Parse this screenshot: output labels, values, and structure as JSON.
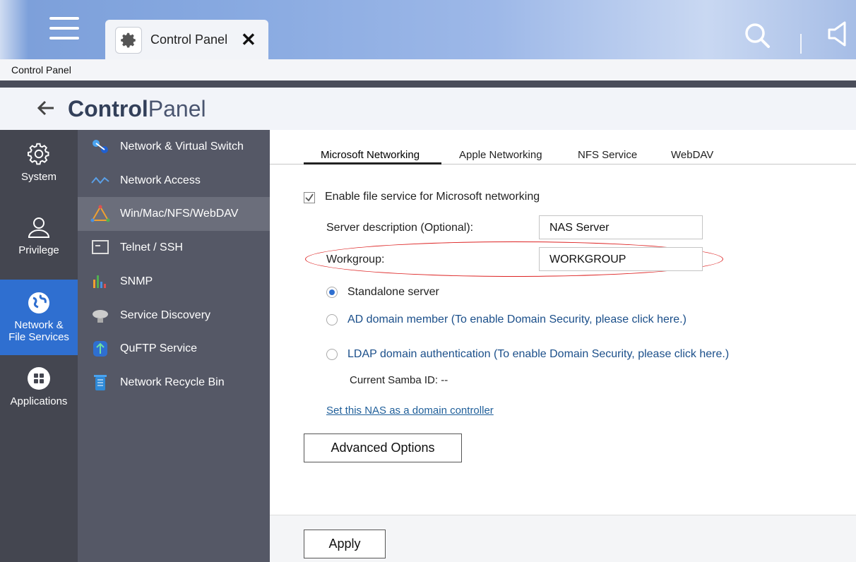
{
  "window": {
    "tab_title": "Control Panel",
    "breadcrumb": "Control Panel"
  },
  "header": {
    "title_bold": "Control",
    "title_light": "Panel"
  },
  "rail": [
    {
      "label": "System",
      "icon": "gear-icon"
    },
    {
      "label": "Privilege",
      "icon": "user-icon"
    },
    {
      "label_line1": "Network &",
      "label_line2": "File Services",
      "icon": "globe-icon",
      "active": true
    },
    {
      "label": "Applications",
      "icon": "apps-grid-icon"
    }
  ],
  "submenu": [
    {
      "label": "Network & Virtual Switch",
      "icon": "network-switch-icon"
    },
    {
      "label": "Network Access",
      "icon": "network-access-icon"
    },
    {
      "label": "Win/Mac/NFS/WebDAV",
      "icon": "file-protocols-icon",
      "active": true
    },
    {
      "label": "Telnet / SSH",
      "icon": "terminal-icon"
    },
    {
      "label": "SNMP",
      "icon": "bar-chart-icon"
    },
    {
      "label": "Service Discovery",
      "icon": "satellite-dish-icon"
    },
    {
      "label": "QuFTP Service",
      "icon": "ftp-icon"
    },
    {
      "label": "Network Recycle Bin",
      "icon": "recycle-bin-icon"
    }
  ],
  "tabs": [
    "Microsoft Networking",
    "Apple Networking",
    "NFS Service",
    "WebDAV"
  ],
  "form": {
    "enable_label": "Enable file service for Microsoft networking",
    "server_desc_label": "Server description (Optional):",
    "server_desc_value": "NAS Server",
    "workgroup_label": "Workgroup:",
    "workgroup_value": "WORKGROUP",
    "radio_standalone": "Standalone server",
    "radio_ad": "AD domain member (To enable Domain Security, please click here.)",
    "radio_ldap": "LDAP domain authentication (To enable Domain Security, please click here.)",
    "samba_id": "Current Samba ID: --",
    "dc_link": "Set this NAS as a domain controller",
    "advanced_button": "Advanced Options",
    "apply_button": "Apply"
  },
  "colors": {
    "accent": "#2f6fd0",
    "highlight_ellipse": "#d22222"
  }
}
